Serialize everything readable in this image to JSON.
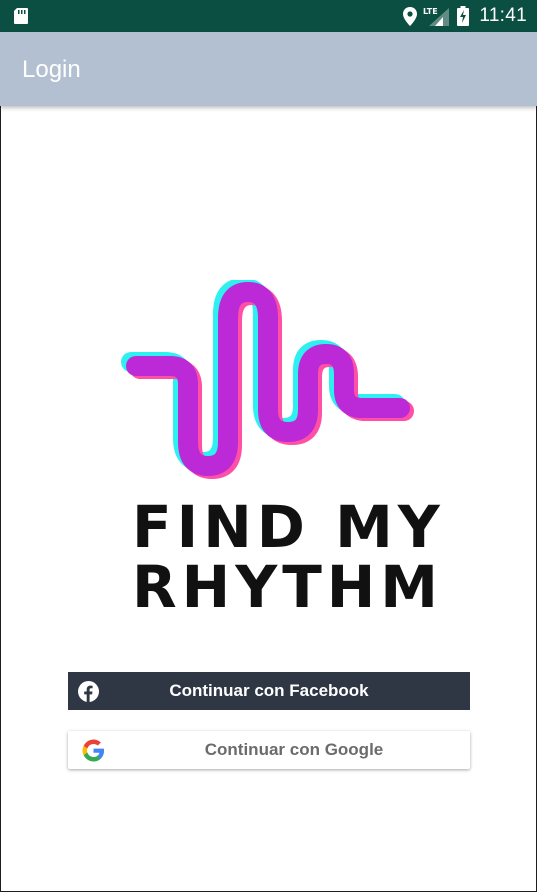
{
  "status_bar": {
    "time": "11:41",
    "network_label": "LTE",
    "left_icon": "sd-card-icon",
    "right_icons": [
      "location-icon",
      "lte-signal-icon",
      "battery-charging-icon"
    ],
    "background": "#0b4f43"
  },
  "app_bar": {
    "title": "Login",
    "background": "#b2c0d1"
  },
  "logo": {
    "line1": "FIND MY",
    "line2": "RHYTHM",
    "icon": "sound-wave-logo-icon",
    "colors": {
      "primary": "#bb2ad6",
      "cyan_shadow": "#2ef0f0",
      "pink_shadow": "#ff4fa6"
    }
  },
  "buttons": {
    "facebook": {
      "label": "Continuar con Facebook",
      "icon": "facebook-icon",
      "background": "#2f3644"
    },
    "google": {
      "label": "Continuar con Google",
      "icon": "google-icon"
    }
  }
}
